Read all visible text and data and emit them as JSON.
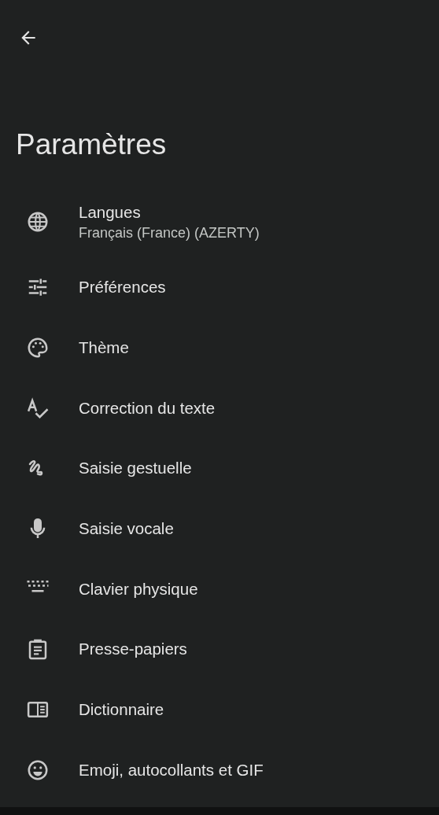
{
  "title": "Paramètres",
  "items": [
    {
      "label": "Langues",
      "subtitle": "Français (France) (AZERTY)"
    },
    {
      "label": "Préférences"
    },
    {
      "label": "Thème"
    },
    {
      "label": "Correction du texte"
    },
    {
      "label": "Saisie gestuelle"
    },
    {
      "label": "Saisie vocale"
    },
    {
      "label": "Clavier physique"
    },
    {
      "label": "Presse-papiers"
    },
    {
      "label": "Dictionnaire"
    },
    {
      "label": "Emoji, autocollants et GIF"
    }
  ]
}
